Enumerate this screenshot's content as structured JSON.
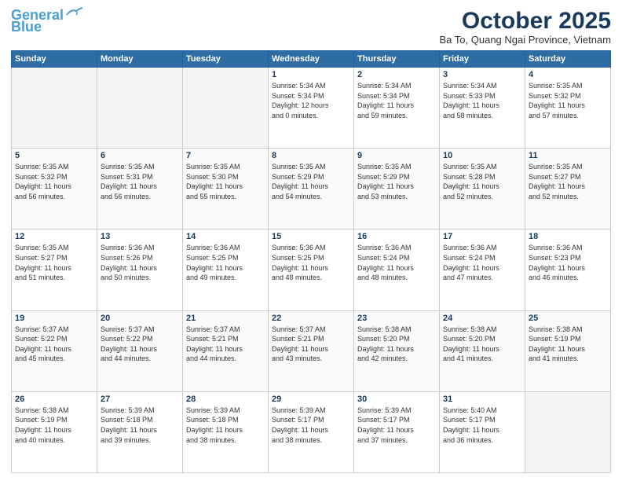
{
  "header": {
    "logo_line1": "General",
    "logo_line2": "Blue",
    "month_title": "October 2025",
    "location": "Ba To, Quang Ngai Province, Vietnam"
  },
  "days_of_week": [
    "Sunday",
    "Monday",
    "Tuesday",
    "Wednesday",
    "Thursday",
    "Friday",
    "Saturday"
  ],
  "weeks": [
    [
      {
        "day": "",
        "info": ""
      },
      {
        "day": "",
        "info": ""
      },
      {
        "day": "",
        "info": ""
      },
      {
        "day": "1",
        "info": "Sunrise: 5:34 AM\nSunset: 5:34 PM\nDaylight: 12 hours\nand 0 minutes."
      },
      {
        "day": "2",
        "info": "Sunrise: 5:34 AM\nSunset: 5:34 PM\nDaylight: 11 hours\nand 59 minutes."
      },
      {
        "day": "3",
        "info": "Sunrise: 5:34 AM\nSunset: 5:33 PM\nDaylight: 11 hours\nand 58 minutes."
      },
      {
        "day": "4",
        "info": "Sunrise: 5:35 AM\nSunset: 5:32 PM\nDaylight: 11 hours\nand 57 minutes."
      }
    ],
    [
      {
        "day": "5",
        "info": "Sunrise: 5:35 AM\nSunset: 5:32 PM\nDaylight: 11 hours\nand 56 minutes."
      },
      {
        "day": "6",
        "info": "Sunrise: 5:35 AM\nSunset: 5:31 PM\nDaylight: 11 hours\nand 56 minutes."
      },
      {
        "day": "7",
        "info": "Sunrise: 5:35 AM\nSunset: 5:30 PM\nDaylight: 11 hours\nand 55 minutes."
      },
      {
        "day": "8",
        "info": "Sunrise: 5:35 AM\nSunset: 5:29 PM\nDaylight: 11 hours\nand 54 minutes."
      },
      {
        "day": "9",
        "info": "Sunrise: 5:35 AM\nSunset: 5:29 PM\nDaylight: 11 hours\nand 53 minutes."
      },
      {
        "day": "10",
        "info": "Sunrise: 5:35 AM\nSunset: 5:28 PM\nDaylight: 11 hours\nand 52 minutes."
      },
      {
        "day": "11",
        "info": "Sunrise: 5:35 AM\nSunset: 5:27 PM\nDaylight: 11 hours\nand 52 minutes."
      }
    ],
    [
      {
        "day": "12",
        "info": "Sunrise: 5:35 AM\nSunset: 5:27 PM\nDaylight: 11 hours\nand 51 minutes."
      },
      {
        "day": "13",
        "info": "Sunrise: 5:36 AM\nSunset: 5:26 PM\nDaylight: 11 hours\nand 50 minutes."
      },
      {
        "day": "14",
        "info": "Sunrise: 5:36 AM\nSunset: 5:25 PM\nDaylight: 11 hours\nand 49 minutes."
      },
      {
        "day": "15",
        "info": "Sunrise: 5:36 AM\nSunset: 5:25 PM\nDaylight: 11 hours\nand 48 minutes."
      },
      {
        "day": "16",
        "info": "Sunrise: 5:36 AM\nSunset: 5:24 PM\nDaylight: 11 hours\nand 48 minutes."
      },
      {
        "day": "17",
        "info": "Sunrise: 5:36 AM\nSunset: 5:24 PM\nDaylight: 11 hours\nand 47 minutes."
      },
      {
        "day": "18",
        "info": "Sunrise: 5:36 AM\nSunset: 5:23 PM\nDaylight: 11 hours\nand 46 minutes."
      }
    ],
    [
      {
        "day": "19",
        "info": "Sunrise: 5:37 AM\nSunset: 5:22 PM\nDaylight: 11 hours\nand 45 minutes."
      },
      {
        "day": "20",
        "info": "Sunrise: 5:37 AM\nSunset: 5:22 PM\nDaylight: 11 hours\nand 44 minutes."
      },
      {
        "day": "21",
        "info": "Sunrise: 5:37 AM\nSunset: 5:21 PM\nDaylight: 11 hours\nand 44 minutes."
      },
      {
        "day": "22",
        "info": "Sunrise: 5:37 AM\nSunset: 5:21 PM\nDaylight: 11 hours\nand 43 minutes."
      },
      {
        "day": "23",
        "info": "Sunrise: 5:38 AM\nSunset: 5:20 PM\nDaylight: 11 hours\nand 42 minutes."
      },
      {
        "day": "24",
        "info": "Sunrise: 5:38 AM\nSunset: 5:20 PM\nDaylight: 11 hours\nand 41 minutes."
      },
      {
        "day": "25",
        "info": "Sunrise: 5:38 AM\nSunset: 5:19 PM\nDaylight: 11 hours\nand 41 minutes."
      }
    ],
    [
      {
        "day": "26",
        "info": "Sunrise: 5:38 AM\nSunset: 5:19 PM\nDaylight: 11 hours\nand 40 minutes."
      },
      {
        "day": "27",
        "info": "Sunrise: 5:39 AM\nSunset: 5:18 PM\nDaylight: 11 hours\nand 39 minutes."
      },
      {
        "day": "28",
        "info": "Sunrise: 5:39 AM\nSunset: 5:18 PM\nDaylight: 11 hours\nand 38 minutes."
      },
      {
        "day": "29",
        "info": "Sunrise: 5:39 AM\nSunset: 5:17 PM\nDaylight: 11 hours\nand 38 minutes."
      },
      {
        "day": "30",
        "info": "Sunrise: 5:39 AM\nSunset: 5:17 PM\nDaylight: 11 hours\nand 37 minutes."
      },
      {
        "day": "31",
        "info": "Sunrise: 5:40 AM\nSunset: 5:17 PM\nDaylight: 11 hours\nand 36 minutes."
      },
      {
        "day": "",
        "info": ""
      }
    ]
  ]
}
